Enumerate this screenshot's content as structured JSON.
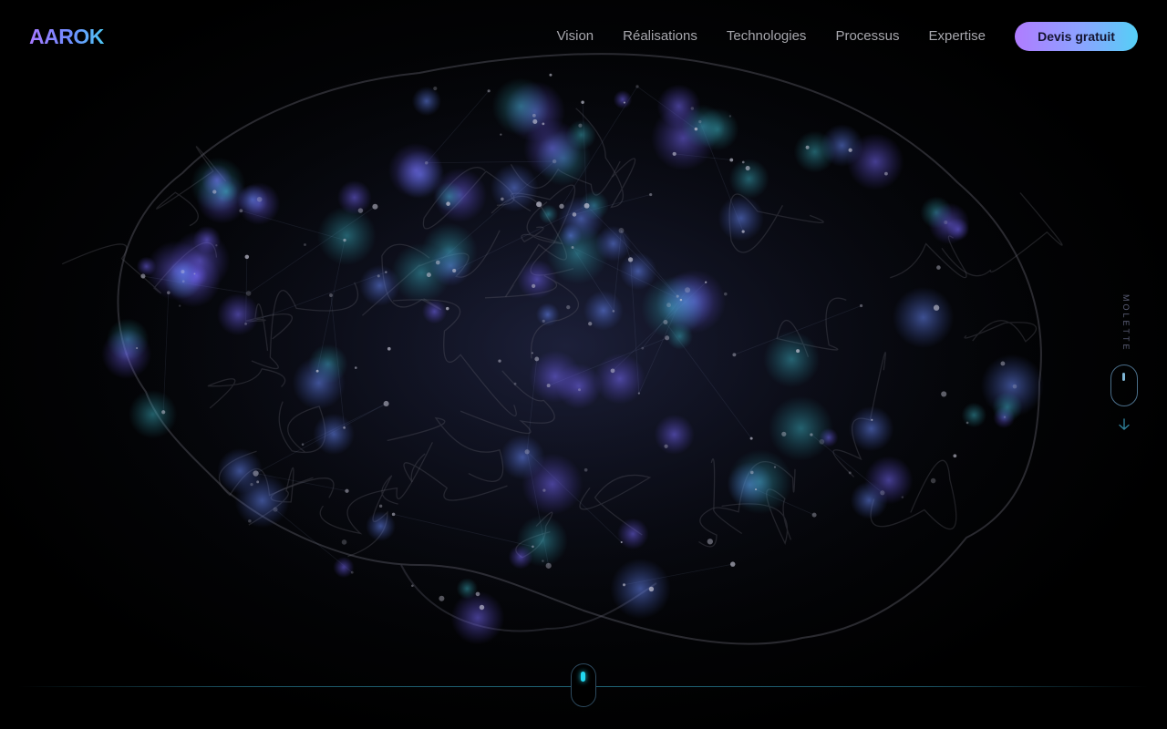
{
  "brand": {
    "logo": "AAROK"
  },
  "nav": {
    "links": [
      "Vision",
      "Réalisations",
      "Technologies",
      "Processus",
      "Expertise"
    ],
    "cta": "Devis gratuit"
  },
  "scroll_hint": {
    "label": "MOLETTE",
    "icons": [
      "mouse-icon",
      "arrow-down-icon"
    ]
  },
  "colors": {
    "background": "#000000",
    "accent_purple": "#a779ff",
    "accent_cyan": "#4fc8f5",
    "glow_cyan": "#22d8f0"
  }
}
